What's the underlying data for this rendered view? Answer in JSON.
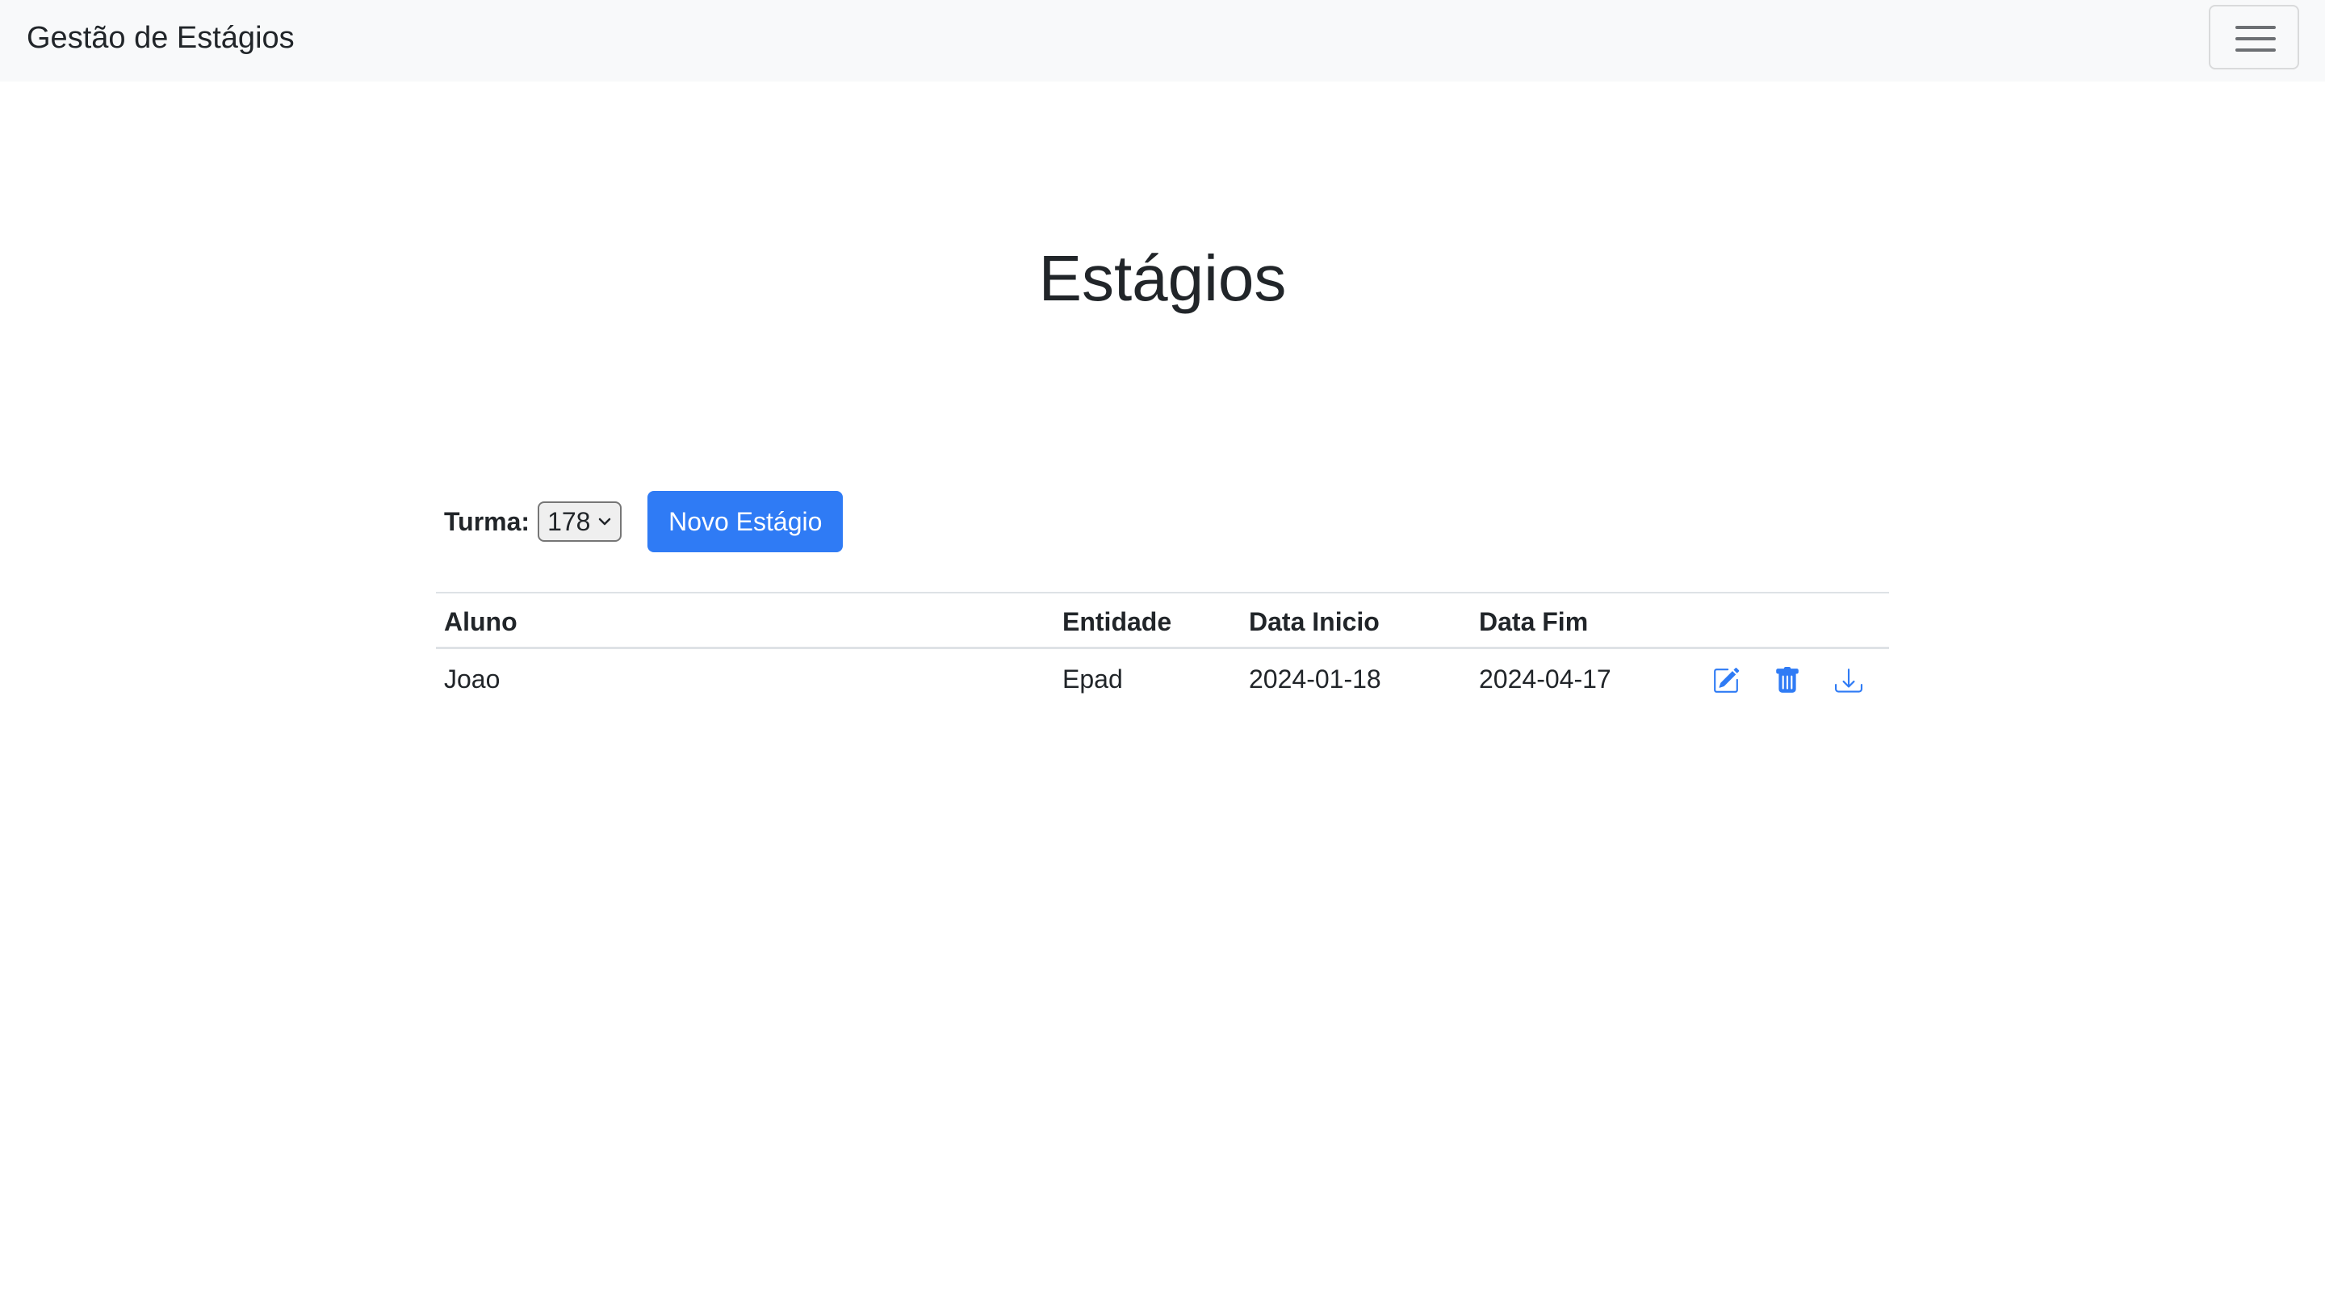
{
  "navbar": {
    "brand": "Gestão de Estágios",
    "menu_toggle_icon": "hamburger-icon"
  },
  "page": {
    "title": "Estágios"
  },
  "filters": {
    "turma_label": "Turma:",
    "turma_selected": "178",
    "new_button_label": "Novo Estágio"
  },
  "table": {
    "columns": [
      "Aluno",
      "Entidade",
      "Data Inicio",
      "Data Fim"
    ],
    "rows": [
      {
        "aluno": "Joao",
        "entidade": "Epad",
        "data_inicio": "2024-01-18",
        "data_fim": "2024-04-17",
        "actions": [
          "edit-icon",
          "trash-icon",
          "download-icon"
        ]
      }
    ]
  },
  "colors": {
    "primary": "#2f7bf5",
    "navbar_bg": "#f8f9fa",
    "icon_blue": "#2f7bf5",
    "text": "#212529"
  }
}
